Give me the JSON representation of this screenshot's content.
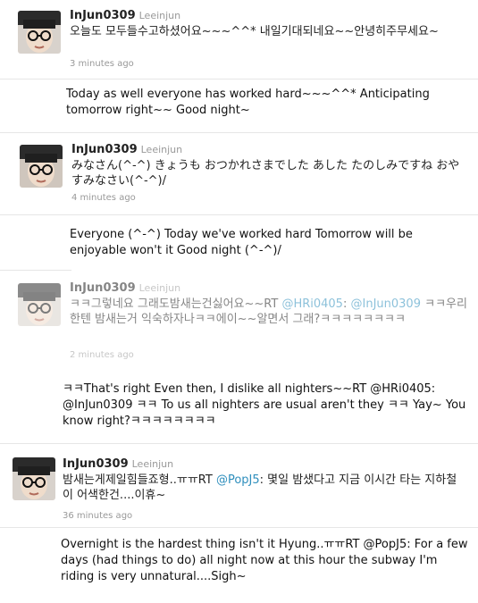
{
  "tweets": [
    {
      "username": "InJun0309",
      "realname": "Leeinjun",
      "text": "오늘도 모두들수고하셨어요~~~^^* 내일기대되네요~~안녕히주무세요~",
      "time": "3 minutes ago",
      "translation": "Today as well everyone has worked hard~~~^^* Anticipating tomorrow right~~ Good night~"
    },
    {
      "username": "InJun0309",
      "realname": "Leeinjun",
      "text": "みなさん(^-^) きょうも おつかれさまでした あした たのしみですね おやすみなさい(^-^)/",
      "time": "4 minutes ago",
      "translation": "Everyone (^-^) Today we've worked hard Tomorrow will be enjoyable won't it Good night (^-^)/"
    },
    {
      "username": "InJun0309",
      "realname": "Leeinjun",
      "text_pre": "ㅋㅋ그렇네요 그래도밤새는건싫어요~~RT ",
      "mention1": "@HRi0405",
      "text_mid": ":",
      "mention2": "@InJun0309",
      "text_post": " ㅋㅋ우리한텐 밤새는거 익숙하자나ㅋㅋ에이~~알면서 그래?ㅋㅋㅋㅋㅋㅋㅋㅋ",
      "time": "2 minutes ago",
      "translation": "ㅋㅋThat's right  Even then, I dislike all nighters~~RT @HRi0405: @InJun0309 ㅋㅋ To us all nighters are usual aren't they ㅋㅋ Yay~ You know right?ㅋㅋㅋㅋㅋㅋㅋㅋ"
    },
    {
      "username": "InJun0309",
      "realname": "Leeinjun",
      "text_pre": "밤새는게제일힘들죠형..ㅠㅠRT ",
      "mention1": "@PopJ5",
      "text_post": ": 몇일 밤샜다고 지금 이시간 타는 지하철이 어색한건....이휴~",
      "time": "36 minutes ago",
      "translation": "Overnight is the hardest thing isn't it Hyung..ㅠㅠRT @PopJ5: For a few days (had things to do) all night now at this hour the subway I'm riding is very unnatural....Sigh~"
    }
  ],
  "colors": {
    "link": "#2f8fbd",
    "username": "#222222",
    "meta": "#999999"
  }
}
